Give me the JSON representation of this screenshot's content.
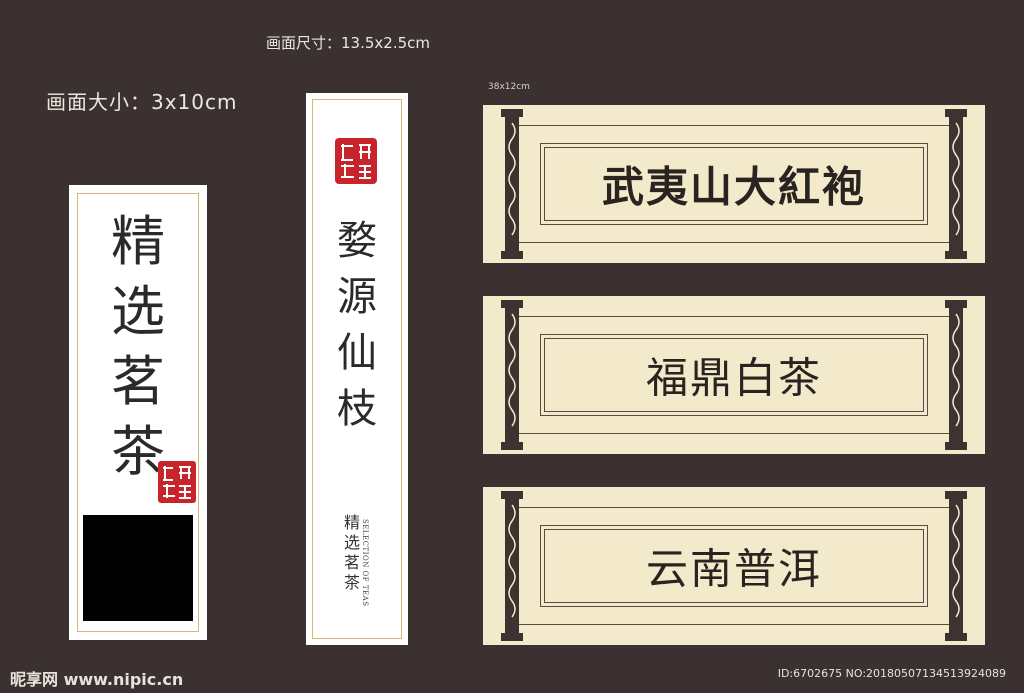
{
  "labels": {
    "left": "画面大小：3x10cm",
    "mid": "画面尺寸：13.5x2.5cm",
    "right": "38x12cm"
  },
  "card_left": {
    "text": [
      "精",
      "选",
      "茗",
      "茶"
    ]
  },
  "card_mid": {
    "text": [
      "婺",
      "源",
      "仙",
      "枝"
    ],
    "small": [
      "精",
      "选",
      "茗",
      "茶"
    ],
    "english": "SELECTION OF TEAS"
  },
  "scrolls": [
    {
      "title": "武夷山大紅袍"
    },
    {
      "title": "福鼎白茶"
    },
    {
      "title": "云南普洱"
    }
  ],
  "watermark": {
    "left": "昵享网 www.nipic.cn",
    "right": "ID:6702675 NO:20180507134513924089"
  },
  "colors": {
    "background": "#3a3130",
    "paper": "#f3eacb",
    "seal": "#c8242b",
    "gold": "#d2b879"
  }
}
